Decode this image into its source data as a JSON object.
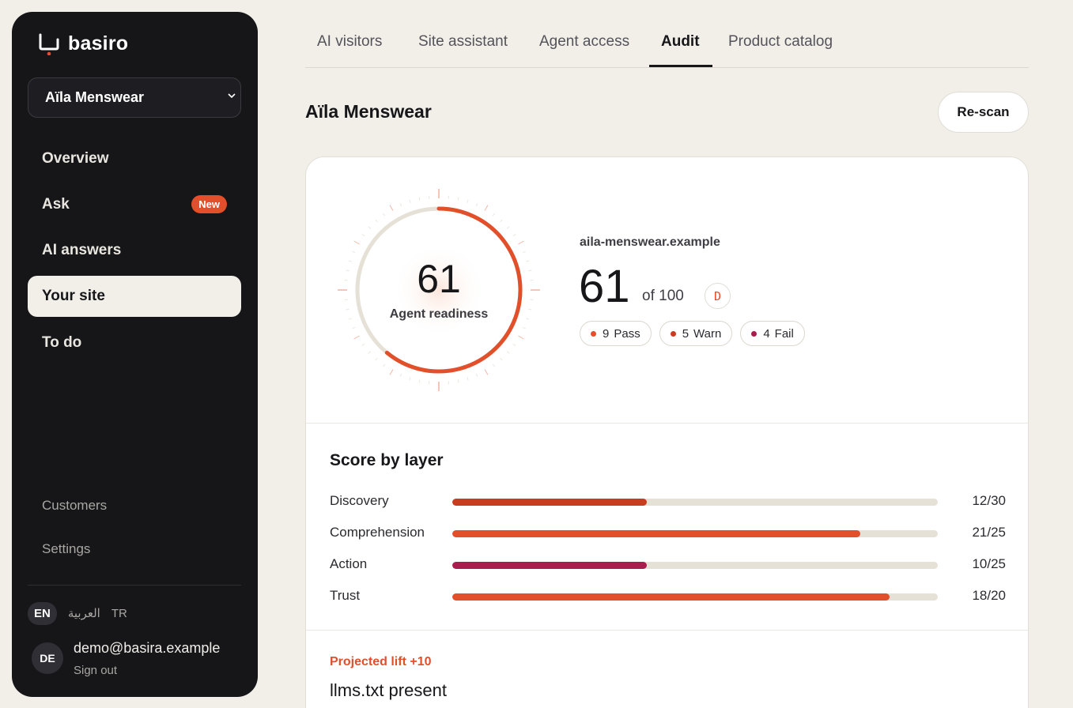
{
  "brand": {
    "name": "basiro",
    "accent": "#e1502a"
  },
  "sidebar": {
    "store": "Aïla Menswear",
    "items": [
      {
        "label": "Overview"
      },
      {
        "label": "Ask",
        "badge": "New"
      },
      {
        "label": "AI answers"
      },
      {
        "label": "Your site",
        "active": true
      },
      {
        "label": "To do"
      }
    ],
    "secondary": [
      {
        "label": "Customers"
      },
      {
        "label": "Settings"
      }
    ],
    "languages": [
      "EN",
      "العربية",
      "TR"
    ],
    "user": {
      "initials": "DE",
      "email": "demo@basira.example",
      "signout": "Sign out"
    }
  },
  "tabs": [
    {
      "label": "AI visitors"
    },
    {
      "label": "Site assistant"
    },
    {
      "label": "Agent access"
    },
    {
      "label": "Audit",
      "active": true
    },
    {
      "label": "Product catalog"
    }
  ],
  "page": {
    "title": "Aïla Menswear",
    "rescan": "Re-scan"
  },
  "audit": {
    "gauge_value": "61",
    "gauge_label": "Agent readiness",
    "gauge_fraction": 0.61,
    "domain": "aila-menswear.example",
    "score": "61",
    "of": "of 100",
    "grade": "D",
    "pills": [
      {
        "count": "9",
        "label": "Pass",
        "color": "#e1502a"
      },
      {
        "count": "5",
        "label": "Warn",
        "color": "#c63d20"
      },
      {
        "count": "4",
        "label": "Fail",
        "color": "#a81d4e"
      }
    ]
  },
  "layers": {
    "title": "Score by layer",
    "items": [
      {
        "name": "Discovery",
        "value": "12/30",
        "fraction": 0.4,
        "color": "#c63d20"
      },
      {
        "name": "Comprehension",
        "value": "21/25",
        "fraction": 0.84,
        "color": "#e1502a"
      },
      {
        "name": "Action",
        "value": "10/25",
        "fraction": 0.4,
        "color": "#a81d4e"
      },
      {
        "name": "Trust",
        "value": "18/20",
        "fraction": 0.9,
        "color": "#e1502a"
      }
    ]
  },
  "finding": {
    "lift": "Projected lift +10",
    "title": "llms.txt present"
  }
}
